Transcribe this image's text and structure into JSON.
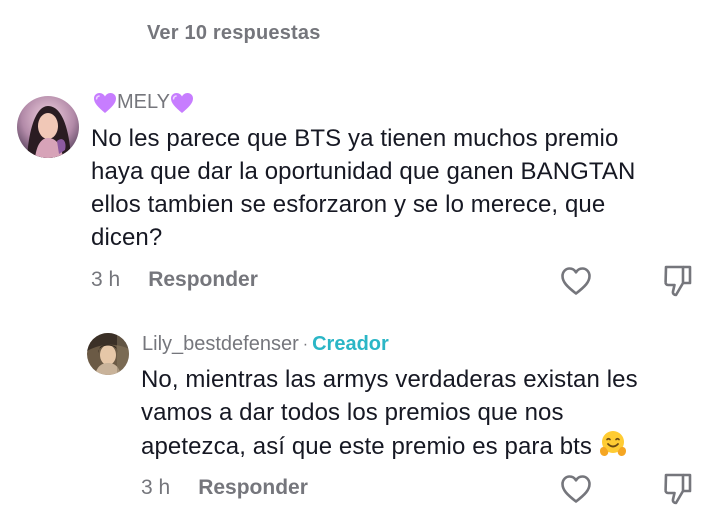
{
  "thread": {
    "view_replies_label": "Ver 10 respuestas"
  },
  "comments": [
    {
      "username": "MELY",
      "username_decoration": "purple-heart-emoji",
      "text_lines": [
        "No les parece que BTS ya tienen muchos premio",
        "haya que dar la oportunidad que ganen BANGTAN",
        "ellos tambien se esforzaron y se lo merece, que",
        "dicen?"
      ],
      "time": "3 h",
      "reply_label": "Responder",
      "like_icon": "heart-outline-icon",
      "dislike_icon": "thumbs-down-icon"
    },
    {
      "username": "Lily_bestdefenser",
      "separator": "·",
      "badge": "Creador",
      "badge_color": "#2bb6c6",
      "text_lines": [
        "No, mientras las armys verdaderas existan les",
        "vamos a dar todos los premios que nos",
        "apetezca, así que este premio es para bts"
      ],
      "trailing_emoji": "hugging-face-emoji",
      "time": "3 h",
      "reply_label": "Responder",
      "like_icon": "heart-outline-icon",
      "dislike_icon": "thumbs-down-icon"
    }
  ],
  "colors": {
    "text_primary": "#161823",
    "text_secondary": "#75767c",
    "creator": "#2bb6c6",
    "heart_emoji": "#c77dff"
  }
}
